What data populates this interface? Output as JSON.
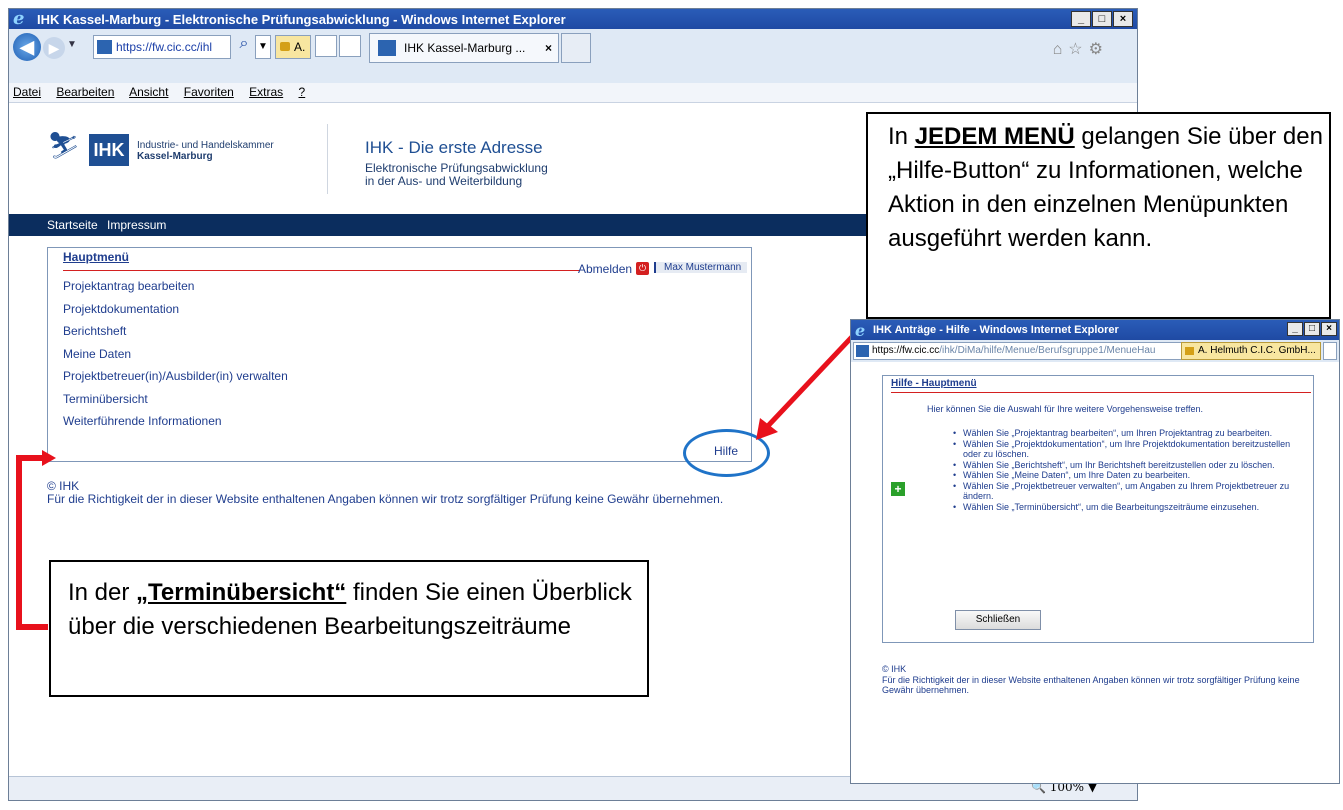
{
  "browser": {
    "title": "IHK Kassel-Marburg - Elektronische Prüfungsabwicklung - Windows Internet Explorer",
    "address": "https://fw.cic.cc/ihl",
    "cert_label": "A.",
    "tab_label": "IHK Kassel-Marburg ...",
    "tab_close": "×",
    "min_label": "_",
    "max_label": "□",
    "close_label": "×",
    "back_glyph": "◀",
    "fwd_glyph": "▶",
    "dropdown_glyph": "▼",
    "search_glyph": "⌕",
    "right_icons": "⌂☆⚙",
    "zoom": "100%",
    "menu": [
      "Datei",
      "Bearbeiten",
      "Ansicht",
      "Favoriten",
      "Extras",
      "?"
    ]
  },
  "header": {
    "logo_text": "IHK",
    "chamber_line1": "Industrie- und Handelskammer",
    "chamber_line2": "Kassel-Marburg",
    "title": "IHK - Die erste Adresse",
    "sub1": "Elektronische Prüfungsabwicklung",
    "sub2": "in der Aus- und Weiterbildung"
  },
  "nav": {
    "home": "Startseite",
    "imprint": "Impressum"
  },
  "main": {
    "title": "Hauptmenü",
    "logout": "Abmelden",
    "user": "Max Mustermann",
    "items": [
      "Projektantrag bearbeiten",
      "Projektdokumentation",
      "Berichtsheft",
      "Meine Daten",
      "Projektbetreuer(in)/Ausbilder(in) verwalten",
      "Terminübersicht",
      "Weiterführende Informationen"
    ],
    "help": "Hilfe"
  },
  "footer": {
    "copyright": "© IHK",
    "disclaimer": "Für die Richtigkeit der in dieser Website enthaltenen Angaben können wir trotz sorgfältiger Prüfung keine Gewähr übernehmen."
  },
  "callout_top": {
    "p1": "In ",
    "bold": "JEDEM MENÜ",
    "p2": " gelangen Sie über den „Hilfe-Button“ zu Informationen, welche Aktion in den einzelnen Menüpunkten ausgeführt werden kann."
  },
  "callout_bottom": {
    "p1": "In der ",
    "bold": "„Terminübersicht“",
    "p2": " finden Sie einen Überblick über die verschiedenen Bearbeitungszeiträume"
  },
  "popup": {
    "title": "IHK Anträge - Hilfe - Windows Internet Explorer",
    "url_host": "https://fw.cic.cc",
    "url_path": "/ihk/DiMa/hilfe/Menue/Berufsgruppe1/MenueHau",
    "cert": "A. Helmuth C.I.C. GmbH...",
    "box_title": "Hilfe - Hauptmenü",
    "intro": "Hier können Sie die Auswahl für Ihre weitere Vorgehensweise treffen.",
    "bullets": [
      "Wählen Sie „Projektantrag bearbeiten“, um Ihren Projektantrag zu bearbeiten.",
      "Wählen Sie „Projektdokumentation“, um Ihre Projektdokumentation bereitzustellen oder zu löschen.",
      "Wählen Sie „Berichtsheft“, um Ihr Berichtsheft bereitzustellen oder zu löschen.",
      "Wählen Sie „Meine Daten“, um Ihre Daten zu bearbeiten.",
      "Wählen Sie „Projektbetreuer verwalten“, um Angaben zu Ihrem Projektbetreuer zu ändern.",
      "Wählen Sie „Terminübersicht“, um die Bearbeitungszeiträume einzusehen."
    ],
    "close_button": "Schließen",
    "footer_copy": "© IHK",
    "footer_text": "Für die Richtigkeit der in dieser Website enthaltenen Angaben können wir trotz sorgfältiger Prüfung keine Gewähr übernehmen."
  },
  "colors": {
    "ie_title": "#1f4aa3",
    "ihk_blue": "#1f4f93",
    "nav_dark": "#0b2d5e",
    "annotation_red": "#e8111c",
    "highlight_ring": "#1f73c8"
  }
}
